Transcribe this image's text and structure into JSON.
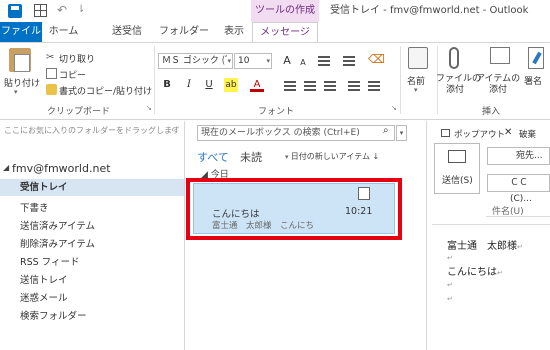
{
  "window": {
    "context_tab": "ツールの作成",
    "title": "受信トレイ - fmv@fmworld.net - Outlook",
    "undo_glyph": "↶",
    "more_glyph": "⇂"
  },
  "tabs": [
    {
      "label": "ファイル"
    },
    {
      "label": "ホーム"
    },
    {
      "label": "送受信"
    },
    {
      "label": "フォルダー"
    },
    {
      "label": "表示"
    },
    {
      "label": "メッセージ"
    }
  ],
  "ribbon": {
    "clipboard": {
      "paste": "貼り付け",
      "cut": "切り取り",
      "copy": "コピー",
      "format_paint": "書式のコピー/貼り付け",
      "group_label": "クリップボード"
    },
    "font": {
      "font_name": "ＭＳ ゴシック (ﾞ",
      "font_size": "10",
      "grow": "A",
      "shrink": "A",
      "bold": "B",
      "italic": "I",
      "underline": "U",
      "highlight": "ab",
      "color": "A",
      "group_label": "フォント"
    },
    "names": {
      "label": "名前"
    },
    "include": {
      "attach_file": "ファイルの\n添付",
      "attach_item": "アイテムの\n添付",
      "signature": "署名",
      "group_label": "挿入"
    }
  },
  "folders_pane": {
    "fav_hint": "ここにお気に入りのフォルダーをドラッグします",
    "account": "fmv@fmworld.net",
    "folders": [
      "受信トレイ",
      "下書き",
      "送信済みアイテム",
      "削除済みアイテム",
      "RSS フィード",
      "送信トレイ",
      "迷惑メール",
      "検索フォルダー"
    ]
  },
  "list_pane": {
    "search_placeholder": "現在のメールボックス の検索 (Ctrl+E)",
    "filter_all": "すべて",
    "filter_unread": "未読",
    "sort": "日付の新しいアイテム ↓",
    "group": "◢ 今日",
    "message": {
      "subject": "こんにちは",
      "time": "10:21",
      "preview": "富士通　太郎様　こんにち"
    }
  },
  "compose": {
    "popout": "ポップアウト",
    "discard": "破棄",
    "send": "送信(S)",
    "to": "宛先...",
    "cc": "ＣＣ(C)...",
    "subject_label": "件名(U)",
    "body": [
      "富士通　太郎様",
      "",
      "こんにちは",
      "",
      ""
    ],
    "pilcrow": "↵"
  },
  "colors": {
    "accent": "#0072c6",
    "context": "#6b2a82",
    "highlight_border": "#e60012",
    "selected_item": "#cde4f7"
  }
}
